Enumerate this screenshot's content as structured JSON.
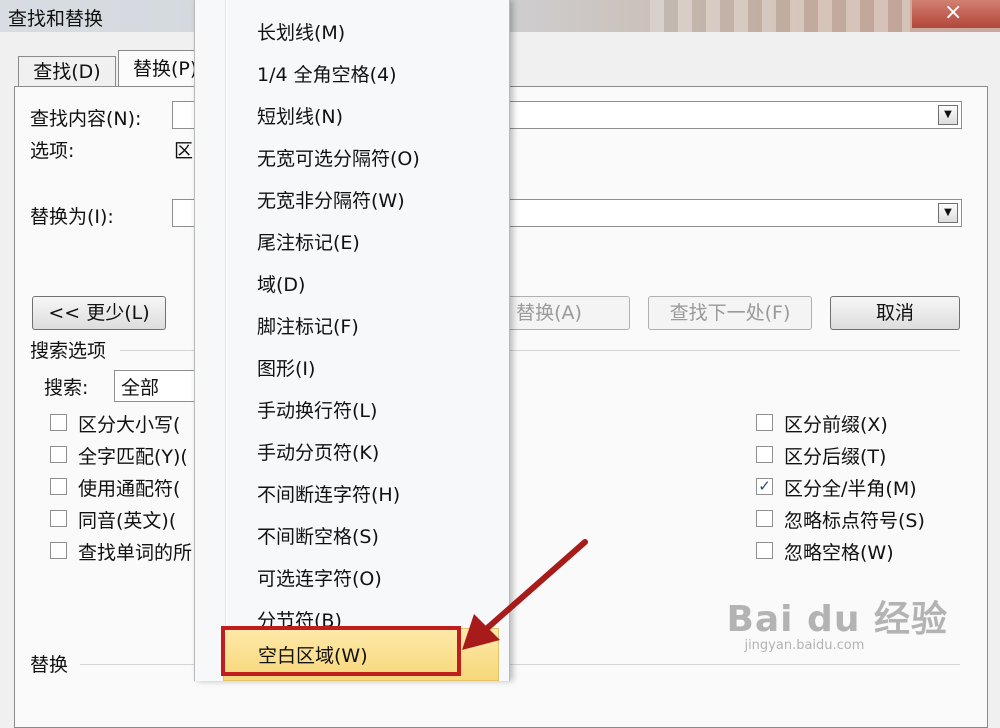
{
  "window": {
    "title": "查找和替换",
    "close_glyph": "×"
  },
  "tabs": {
    "find": "查找(D)",
    "replace": "替换(P)"
  },
  "form": {
    "find_label": "查找内容(N):",
    "options_label": "选项:",
    "options_value": "区",
    "replace_label": "替换为(I):"
  },
  "buttons": {
    "less": "<< 更少(L)",
    "replace": "替换(A)",
    "find_next": "查找下一处(F)",
    "cancel": "取消"
  },
  "search_options": {
    "heading": "搜索选项",
    "search_label": "搜索:",
    "search_value": "全部",
    "left_checks": [
      {
        "label": "区分大小写(",
        "checked": false
      },
      {
        "label": "全字匹配(Y)(",
        "checked": false
      },
      {
        "label": "使用通配符(",
        "checked": false
      },
      {
        "label": "同音(英文)(",
        "checked": false
      },
      {
        "label": "查找单词的所",
        "checked": false
      }
    ],
    "right_checks": [
      {
        "label": "区分前缀(X)",
        "checked": false
      },
      {
        "label": "区分后缀(T)",
        "checked": false
      },
      {
        "label": "区分全/半角(M)",
        "checked": true
      },
      {
        "label": "忽略标点符号(S)",
        "checked": false
      },
      {
        "label": "忽略空格(W)",
        "checked": false
      }
    ],
    "replace_heading": "替换"
  },
  "menu": {
    "items": [
      "长划线(M)",
      "1/4 全角空格(4)",
      "短划线(N)",
      "无宽可选分隔符(O)",
      "无宽非分隔符(W)",
      "尾注标记(E)",
      "域(D)",
      "脚注标记(F)",
      "图形(I)",
      "手动换行符(L)",
      "手动分页符(K)",
      "不间断连字符(H)",
      "不间断空格(S)",
      "可选连字符(O)",
      "分节符(B)"
    ],
    "highlighted": "空白区域(W)"
  },
  "watermark": {
    "brand": "Bai du 经验",
    "url": "jingyan.baidu.com"
  },
  "colors": {
    "highlight": "#f8d77a",
    "annotation_red": "#c01e1e"
  }
}
